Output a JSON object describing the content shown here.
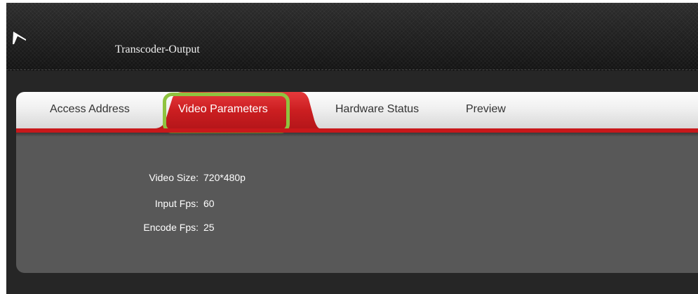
{
  "header": {
    "logo_icon": "stylized-a-logo-icon",
    "title": "Transcoder-Output"
  },
  "tabs": [
    {
      "label": "Access Address",
      "active": false
    },
    {
      "label": "Video Parameters",
      "active": true
    },
    {
      "label": "Hardware Status",
      "active": false
    },
    {
      "label": "Preview",
      "active": false
    }
  ],
  "video_parameters": {
    "rows": [
      {
        "label": "Video Size:",
        "value": "720*480p"
      },
      {
        "label": "Input Fps:",
        "value": "60"
      },
      {
        "label": "Encode Fps:",
        "value": "25"
      }
    ]
  },
  "colors": {
    "accent_red": "#c8181b",
    "highlight_green": "#8fc33f",
    "panel_gray": "#585858",
    "background_dark": "#262626"
  }
}
